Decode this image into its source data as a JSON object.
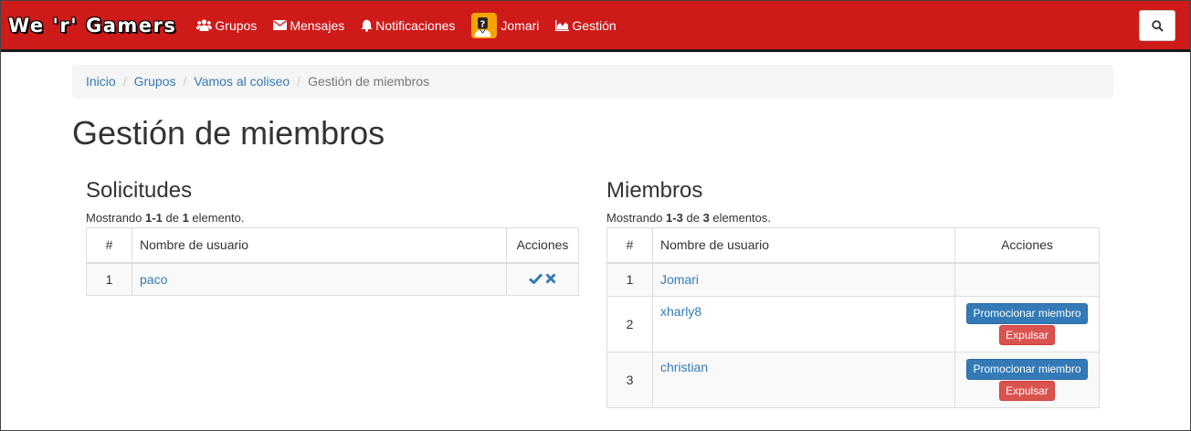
{
  "navbar": {
    "brand": "We 'r' Gamers",
    "items": [
      {
        "label": "Grupos",
        "icon": "users-icon"
      },
      {
        "label": "Mensajes",
        "icon": "envelope-icon"
      },
      {
        "label": "Notificaciones",
        "icon": "bell-icon"
      },
      {
        "label": "Jomari",
        "icon": "avatar"
      },
      {
        "label": "Gestión",
        "icon": "area-chart-icon"
      }
    ],
    "search_icon": "search-icon",
    "color": "#cf1a1a"
  },
  "breadcrumb": [
    "Inicio",
    "Grupos",
    "Vamos al coliseo",
    "Gestión de miembros"
  ],
  "page_title": "Gestión de miembros",
  "requests": {
    "title": "Solicitudes",
    "showing_prefix": "Mostrando",
    "range": "1-1",
    "of_word": "de",
    "total": "1",
    "suffix": "elemento.",
    "columns": [
      "#",
      "Nombre de usuario",
      "Acciones"
    ],
    "rows": [
      {
        "num": "1",
        "user": "paco"
      }
    ]
  },
  "members": {
    "title": "Miembros",
    "showing_prefix": "Mostrando",
    "range": "1-3",
    "of_word": "de",
    "total": "3",
    "suffix": "elementos.",
    "columns": [
      "#",
      "Nombre de usuario",
      "Acciones"
    ],
    "promote_label": "Promocionar miembro",
    "expel_label": "Expulsar",
    "rows": [
      {
        "num": "1",
        "user": "Jomari"
      },
      {
        "num": "2",
        "user": "xharly8"
      },
      {
        "num": "3",
        "user": "christian"
      }
    ]
  }
}
